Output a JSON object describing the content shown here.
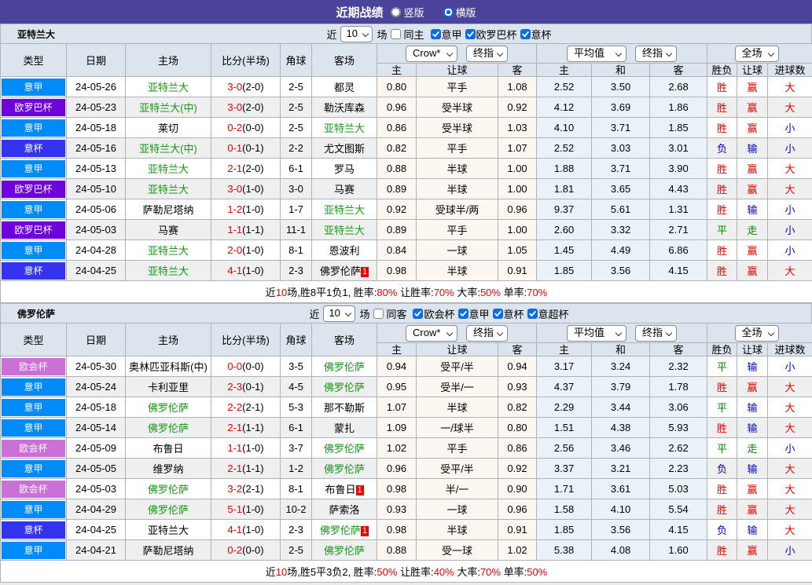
{
  "title_bar": {
    "title": "近期战绩",
    "radio_vertical": {
      "label": "竖版",
      "state": "off"
    },
    "radio_horizontal": {
      "label": "横版",
      "state": "on"
    }
  },
  "table_header": {
    "col_type": "类型",
    "col_date": "日期",
    "col_home": "主场",
    "col_score": "比分(半场)",
    "col_corner": "角球",
    "col_away": "客场",
    "odds_select_book": "Crow*",
    "odds_select_time": "终指",
    "odds_sub_home": "主",
    "odds_sub_handicap": "让球",
    "odds_sub_away": "客",
    "avg_select_kind": "平均值",
    "avg_select_time": "终指",
    "avg_sub_home": "主",
    "avg_sub_draw": "和",
    "avg_sub_away": "客",
    "result_select_scope": "全场",
    "result_sub_outcome": "胜负",
    "result_sub_handicap": "让球",
    "result_sub_goals": "进球数"
  },
  "teams": [
    {
      "name": "亚特兰大",
      "filter": {
        "near_label": "近",
        "count_value": "10",
        "games_label": "场",
        "same_label": "同主",
        "same_state": "off",
        "leagues": [
          {
            "label": "意甲",
            "state": "on"
          },
          {
            "label": "欧罗巴杯",
            "state": "on"
          },
          {
            "label": "意杯",
            "state": "on"
          }
        ]
      },
      "rows": [
        {
          "league": "意甲",
          "league_class": "lg-blue",
          "date": "24-05-26",
          "home": "亚特兰大",
          "home_class": "green",
          "score_ft": "3-0",
          "score_ht": "(2-0)",
          "corner": "2-5",
          "away": "都灵",
          "away_class": "",
          "away_badge": "",
          "odds_home": "0.80",
          "handicap": "平手",
          "odds_away": "1.08",
          "avg_home": "2.52",
          "avg_draw": "3.50",
          "avg_away": "2.68",
          "res": [
            {
              "t": "胜",
              "c": "res-w"
            },
            {
              "t": "赢",
              "c": "res-w"
            },
            {
              "t": "大",
              "c": "res-w"
            }
          ]
        },
        {
          "league": "欧罗巴杯",
          "league_class": "lg-violet",
          "date": "24-05-23",
          "home": "亚特兰大(中)",
          "home_class": "green",
          "score_ft": "3-0",
          "score_ht": "(2-0)",
          "corner": "2-5",
          "away": "勒沃库森",
          "away_class": "",
          "away_badge": "",
          "odds_home": "0.96",
          "handicap": "受半球",
          "odds_away": "0.92",
          "avg_home": "4.12",
          "avg_draw": "3.69",
          "avg_away": "1.86",
          "res": [
            {
              "t": "胜",
              "c": "res-w"
            },
            {
              "t": "赢",
              "c": "res-w"
            },
            {
              "t": "大",
              "c": "res-w"
            }
          ]
        },
        {
          "league": "意甲",
          "league_class": "lg-blue",
          "date": "24-05-18",
          "home": "莱切",
          "home_class": "",
          "score_ft": "0-2",
          "score_ht": "(0-0)",
          "corner": "2-5",
          "away": "亚特兰大",
          "away_class": "green",
          "away_badge": "",
          "odds_home": "0.86",
          "handicap": "受半球",
          "odds_away": "1.03",
          "avg_home": "4.10",
          "avg_draw": "3.71",
          "avg_away": "1.85",
          "res": [
            {
              "t": "胜",
              "c": "res-w"
            },
            {
              "t": "赢",
              "c": "res-w"
            },
            {
              "t": "小",
              "c": "res-l"
            }
          ]
        },
        {
          "league": "意杯",
          "league_class": "lg-indigo",
          "date": "24-05-16",
          "home": "亚特兰大(中)",
          "home_class": "green",
          "score_ft": "0-1",
          "score_ht": "(0-1)",
          "corner": "2-2",
          "away": "尤文图斯",
          "away_class": "",
          "away_badge": "",
          "odds_home": "0.82",
          "handicap": "平手",
          "odds_away": "1.07",
          "avg_home": "2.52",
          "avg_draw": "3.03",
          "avg_away": "3.01",
          "res": [
            {
              "t": "负",
              "c": "res-l"
            },
            {
              "t": "输",
              "c": "res-l"
            },
            {
              "t": "小",
              "c": "res-l"
            }
          ]
        },
        {
          "league": "意甲",
          "league_class": "lg-blue",
          "date": "24-05-13",
          "home": "亚特兰大",
          "home_class": "green",
          "score_ft": "2-1",
          "score_ht": "(2-0)",
          "corner": "6-1",
          "away": "罗马",
          "away_class": "",
          "away_badge": "",
          "odds_home": "0.88",
          "handicap": "半球",
          "odds_away": "1.00",
          "avg_home": "1.88",
          "avg_draw": "3.71",
          "avg_away": "3.90",
          "res": [
            {
              "t": "胜",
              "c": "res-w"
            },
            {
              "t": "赢",
              "c": "res-w"
            },
            {
              "t": "大",
              "c": "res-w"
            }
          ]
        },
        {
          "league": "欧罗巴杯",
          "league_class": "lg-violet",
          "date": "24-05-10",
          "home": "亚特兰大",
          "home_class": "green",
          "score_ft": "3-0",
          "score_ht": "(1-0)",
          "corner": "3-0",
          "away": "马赛",
          "away_class": "",
          "away_badge": "",
          "odds_home": "0.89",
          "handicap": "半球",
          "odds_away": "1.00",
          "avg_home": "1.81",
          "avg_draw": "3.65",
          "avg_away": "4.43",
          "res": [
            {
              "t": "胜",
              "c": "res-w"
            },
            {
              "t": "赢",
              "c": "res-w"
            },
            {
              "t": "大",
              "c": "res-w"
            }
          ]
        },
        {
          "league": "意甲",
          "league_class": "lg-blue",
          "date": "24-05-06",
          "home": "萨勒尼塔纳",
          "home_class": "",
          "score_ft": "1-2",
          "score_ht": "(1-0)",
          "corner": "1-7",
          "away": "亚特兰大",
          "away_class": "green",
          "away_badge": "",
          "odds_home": "0.92",
          "handicap": "受球半/两",
          "odds_away": "0.96",
          "avg_home": "9.37",
          "avg_draw": "5.61",
          "avg_away": "1.31",
          "res": [
            {
              "t": "胜",
              "c": "res-w"
            },
            {
              "t": "输",
              "c": "res-l"
            },
            {
              "t": "小",
              "c": "res-l"
            }
          ]
        },
        {
          "league": "欧罗巴杯",
          "league_class": "lg-violet",
          "date": "24-05-03",
          "home": "马赛",
          "home_class": "",
          "score_ft": "1-1",
          "score_ht": "(1-1)",
          "corner": "11-1",
          "away": "亚特兰大",
          "away_class": "green",
          "away_badge": "",
          "odds_home": "0.89",
          "handicap": "平手",
          "odds_away": "1.00",
          "avg_home": "2.60",
          "avg_draw": "3.32",
          "avg_away": "2.71",
          "res": [
            {
              "t": "平",
              "c": "res-d"
            },
            {
              "t": "走",
              "c": "res-d"
            },
            {
              "t": "小",
              "c": "res-l"
            }
          ]
        },
        {
          "league": "意甲",
          "league_class": "lg-blue",
          "date": "24-04-28",
          "home": "亚特兰大",
          "home_class": "green",
          "score_ft": "2-0",
          "score_ht": "(1-0)",
          "corner": "8-1",
          "away": "恩波利",
          "away_class": "",
          "away_badge": "",
          "odds_home": "0.84",
          "handicap": "一球",
          "odds_away": "1.05",
          "avg_home": "1.45",
          "avg_draw": "4.49",
          "avg_away": "6.86",
          "res": [
            {
              "t": "胜",
              "c": "res-w"
            },
            {
              "t": "赢",
              "c": "res-w"
            },
            {
              "t": "小",
              "c": "res-l"
            }
          ]
        },
        {
          "league": "意杯",
          "league_class": "lg-indigo",
          "date": "24-04-25",
          "home": "亚特兰大",
          "home_class": "green",
          "score_ft": "4-1",
          "score_ht": "(1-0)",
          "corner": "2-3",
          "away": "佛罗伦萨",
          "away_class": "",
          "away_badge": "1",
          "odds_home": "0.98",
          "handicap": "半球",
          "odds_away": "0.91",
          "avg_home": "1.85",
          "avg_draw": "3.56",
          "avg_away": "4.15",
          "res": [
            {
              "t": "胜",
              "c": "res-w"
            },
            {
              "t": "赢",
              "c": "res-w"
            },
            {
              "t": "大",
              "c": "res-w"
            }
          ]
        }
      ],
      "summary": [
        {
          "t": "近",
          "c": "seg-k"
        },
        {
          "t": "10",
          "c": "seg-r"
        },
        {
          "t": "场,胜8平1负1, 胜率:",
          "c": "seg-k"
        },
        {
          "t": "80%",
          "c": "seg-r"
        },
        {
          "t": " 让胜率:",
          "c": "seg-k"
        },
        {
          "t": "70%",
          "c": "seg-r"
        },
        {
          "t": " 大率:",
          "c": "seg-k"
        },
        {
          "t": "50%",
          "c": "seg-r"
        },
        {
          "t": " 单率:",
          "c": "seg-k"
        },
        {
          "t": "70%",
          "c": "seg-r"
        }
      ]
    },
    {
      "name": "佛罗伦萨",
      "filter": {
        "near_label": "近",
        "count_value": "10",
        "games_label": "场",
        "same_label": "同客",
        "same_state": "off",
        "leagues": [
          {
            "label": "欧会杯",
            "state": "on"
          },
          {
            "label": "意甲",
            "state": "on"
          },
          {
            "label": "意杯",
            "state": "on"
          },
          {
            "label": "意超杯",
            "state": "on"
          }
        ]
      },
      "rows": [
        {
          "league": "欧会杯",
          "league_class": "lg-orchid",
          "date": "24-05-30",
          "home": "奥林匹亚科斯(中)",
          "home_class": "",
          "score_ft": "0-0",
          "score_ht": "(0-0)",
          "corner": "3-5",
          "away": "佛罗伦萨",
          "away_class": "green",
          "away_badge": "",
          "odds_home": "0.94",
          "handicap": "受平/半",
          "odds_away": "0.94",
          "avg_home": "3.17",
          "avg_draw": "3.24",
          "avg_away": "2.32",
          "res": [
            {
              "t": "平",
              "c": "res-d"
            },
            {
              "t": "输",
              "c": "res-l"
            },
            {
              "t": "小",
              "c": "res-l"
            }
          ]
        },
        {
          "league": "意甲",
          "league_class": "lg-blue",
          "date": "24-05-24",
          "home": "卡利亚里",
          "home_class": "",
          "score_ft": "2-3",
          "score_ht": "(0-1)",
          "corner": "4-5",
          "away": "佛罗伦萨",
          "away_class": "green",
          "away_badge": "",
          "odds_home": "0.95",
          "handicap": "受半/一",
          "odds_away": "0.93",
          "avg_home": "4.37",
          "avg_draw": "3.79",
          "avg_away": "1.78",
          "res": [
            {
              "t": "胜",
              "c": "res-w"
            },
            {
              "t": "赢",
              "c": "res-w"
            },
            {
              "t": "大",
              "c": "res-w"
            }
          ]
        },
        {
          "league": "意甲",
          "league_class": "lg-blue",
          "date": "24-05-18",
          "home": "佛罗伦萨",
          "home_class": "green",
          "score_ft": "2-2",
          "score_ht": "(2-1)",
          "corner": "5-3",
          "away": "那不勒斯",
          "away_class": "",
          "away_badge": "",
          "odds_home": "1.07",
          "handicap": "半球",
          "odds_away": "0.82",
          "avg_home": "2.29",
          "avg_draw": "3.44",
          "avg_away": "3.06",
          "res": [
            {
              "t": "平",
              "c": "res-d"
            },
            {
              "t": "输",
              "c": "res-l"
            },
            {
              "t": "大",
              "c": "res-w"
            }
          ]
        },
        {
          "league": "意甲",
          "league_class": "lg-blue",
          "date": "24-05-14",
          "home": "佛罗伦萨",
          "home_class": "green",
          "score_ft": "2-1",
          "score_ht": "(1-1)",
          "corner": "6-1",
          "away": "蒙扎",
          "away_class": "",
          "away_badge": "",
          "odds_home": "1.09",
          "handicap": "一/球半",
          "odds_away": "0.80",
          "avg_home": "1.51",
          "avg_draw": "4.38",
          "avg_away": "5.93",
          "res": [
            {
              "t": "胜",
              "c": "res-w"
            },
            {
              "t": "输",
              "c": "res-l"
            },
            {
              "t": "大",
              "c": "res-w"
            }
          ]
        },
        {
          "league": "欧会杯",
          "league_class": "lg-orchid",
          "date": "24-05-09",
          "home": "布鲁日",
          "home_class": "",
          "score_ft": "1-1",
          "score_ht": "(1-0)",
          "corner": "3-7",
          "away": "佛罗伦萨",
          "away_class": "green",
          "away_badge": "",
          "odds_home": "1.02",
          "handicap": "平手",
          "odds_away": "0.86",
          "avg_home": "2.56",
          "avg_draw": "3.46",
          "avg_away": "2.62",
          "res": [
            {
              "t": "平",
              "c": "res-d"
            },
            {
              "t": "走",
              "c": "res-d"
            },
            {
              "t": "小",
              "c": "res-l"
            }
          ]
        },
        {
          "league": "意甲",
          "league_class": "lg-blue",
          "date": "24-05-05",
          "home": "维罗纳",
          "home_class": "",
          "score_ft": "2-1",
          "score_ht": "(1-1)",
          "corner": "1-2",
          "away": "佛罗伦萨",
          "away_class": "green",
          "away_badge": "",
          "odds_home": "0.96",
          "handicap": "受平/半",
          "odds_away": "0.92",
          "avg_home": "3.37",
          "avg_draw": "3.21",
          "avg_away": "2.23",
          "res": [
            {
              "t": "负",
              "c": "res-l"
            },
            {
              "t": "输",
              "c": "res-l"
            },
            {
              "t": "大",
              "c": "res-w"
            }
          ]
        },
        {
          "league": "欧会杯",
          "league_class": "lg-orchid",
          "date": "24-05-03",
          "home": "佛罗伦萨",
          "home_class": "green",
          "score_ft": "3-2",
          "score_ht": "(2-1)",
          "corner": "8-1",
          "away": "布鲁日",
          "away_class": "",
          "away_badge": "1",
          "odds_home": "0.98",
          "handicap": "半/一",
          "odds_away": "0.90",
          "avg_home": "1.71",
          "avg_draw": "3.61",
          "avg_away": "5.03",
          "res": [
            {
              "t": "胜",
              "c": "res-w"
            },
            {
              "t": "赢",
              "c": "res-w"
            },
            {
              "t": "大",
              "c": "res-w"
            }
          ]
        },
        {
          "league": "意甲",
          "league_class": "lg-blue",
          "date": "24-04-29",
          "home": "佛罗伦萨",
          "home_class": "green",
          "score_ft": "5-1",
          "score_ht": "(1-0)",
          "corner": "10-2",
          "away": "萨索洛",
          "away_class": "",
          "away_badge": "",
          "odds_home": "0.93",
          "handicap": "一球",
          "odds_away": "0.96",
          "avg_home": "1.58",
          "avg_draw": "4.10",
          "avg_away": "5.54",
          "res": [
            {
              "t": "胜",
              "c": "res-w"
            },
            {
              "t": "赢",
              "c": "res-w"
            },
            {
              "t": "大",
              "c": "res-w"
            }
          ]
        },
        {
          "league": "意杯",
          "league_class": "lg-indigo",
          "date": "24-04-25",
          "home": "亚特兰大",
          "home_class": "",
          "score_ft": "4-1",
          "score_ht": "(1-0)",
          "corner": "2-3",
          "away": "佛罗伦萨",
          "away_class": "green",
          "away_badge": "1",
          "odds_home": "0.98",
          "handicap": "半球",
          "odds_away": "0.91",
          "avg_home": "1.85",
          "avg_draw": "3.56",
          "avg_away": "4.15",
          "res": [
            {
              "t": "负",
              "c": "res-l"
            },
            {
              "t": "输",
              "c": "res-l"
            },
            {
              "t": "大",
              "c": "res-w"
            }
          ]
        },
        {
          "league": "意甲",
          "league_class": "lg-blue",
          "date": "24-04-21",
          "home": "萨勒尼塔纳",
          "home_class": "",
          "score_ft": "0-2",
          "score_ht": "(0-0)",
          "corner": "2-5",
          "away": "佛罗伦萨",
          "away_class": "green",
          "away_badge": "",
          "odds_home": "0.88",
          "handicap": "受一球",
          "odds_away": "1.02",
          "avg_home": "5.38",
          "avg_draw": "4.08",
          "avg_away": "1.60",
          "res": [
            {
              "t": "胜",
              "c": "res-w"
            },
            {
              "t": "赢",
              "c": "res-w"
            },
            {
              "t": "小",
              "c": "res-l"
            }
          ]
        }
      ],
      "summary": [
        {
          "t": "近",
          "c": "seg-k"
        },
        {
          "t": "10",
          "c": "seg-r"
        },
        {
          "t": "场,胜5平3负2, 胜率:",
          "c": "seg-k"
        },
        {
          "t": "50%",
          "c": "seg-r"
        },
        {
          "t": " 让胜率:",
          "c": "seg-k"
        },
        {
          "t": "40%",
          "c": "seg-r"
        },
        {
          "t": " 大率:",
          "c": "seg-k"
        },
        {
          "t": "70%",
          "c": "seg-r"
        },
        {
          "t": " 单率:",
          "c": "seg-k"
        },
        {
          "t": "50%",
          "c": "seg-r"
        }
      ]
    }
  ]
}
